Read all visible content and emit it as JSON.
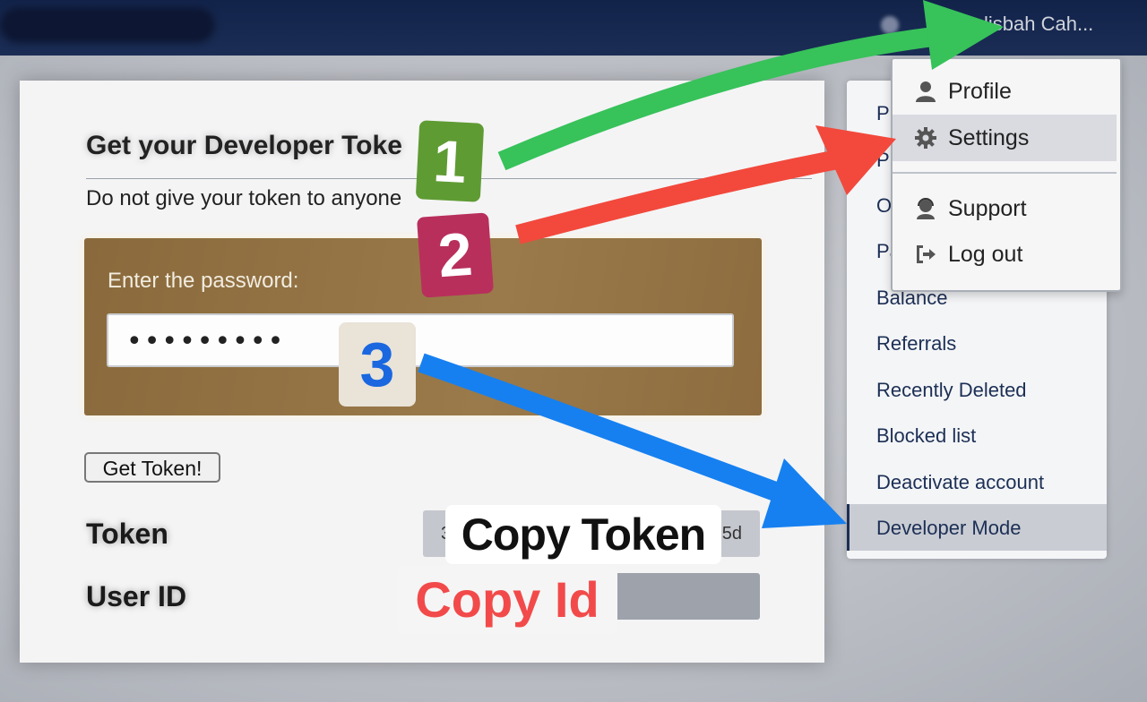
{
  "topbar": {
    "user_name": "lisbah Cah..."
  },
  "main": {
    "title": "Get your Developer Toke",
    "subtitle": "Do not give your token to anyone",
    "password_label": "Enter the password:",
    "password_value": "•••••••••",
    "get_token_button": "Get Token!",
    "token_label": "Token",
    "token_value_start": "3",
    "token_value_end": "5d",
    "user_id_label": "User ID"
  },
  "sidebar": {
    "items": [
      {
        "label": "Pr"
      },
      {
        "label": "Pr"
      },
      {
        "label": "O"
      },
      {
        "label": "Pa"
      },
      {
        "label": "Balance"
      },
      {
        "label": "Referrals"
      },
      {
        "label": "Recently Deleted"
      },
      {
        "label": "Blocked list"
      },
      {
        "label": "Deactivate account"
      },
      {
        "label": "Developer Mode"
      }
    ],
    "active_item": "Developer Mode"
  },
  "dropdown": {
    "items": [
      {
        "label": "Profile",
        "icon": "user-icon"
      },
      {
        "label": "Settings",
        "icon": "gear-icon"
      },
      {
        "label": "Support",
        "icon": "headset-icon"
      },
      {
        "label": "Log out",
        "icon": "logout-icon"
      }
    ],
    "highlighted_item": "Settings"
  },
  "annotations": {
    "step1": "1",
    "step2": "2",
    "step3": "3",
    "copy_token": "Copy Token",
    "copy_id": "Copy Id",
    "colors": {
      "step1": "#5f9b33",
      "step2": "#b82f5c",
      "step3": "#1a67e0",
      "green_arrow": "#37c25a",
      "red_arrow": "#f2493c",
      "blue_arrow": "#1680f0",
      "copy_id_text": "#f24a4a"
    }
  }
}
